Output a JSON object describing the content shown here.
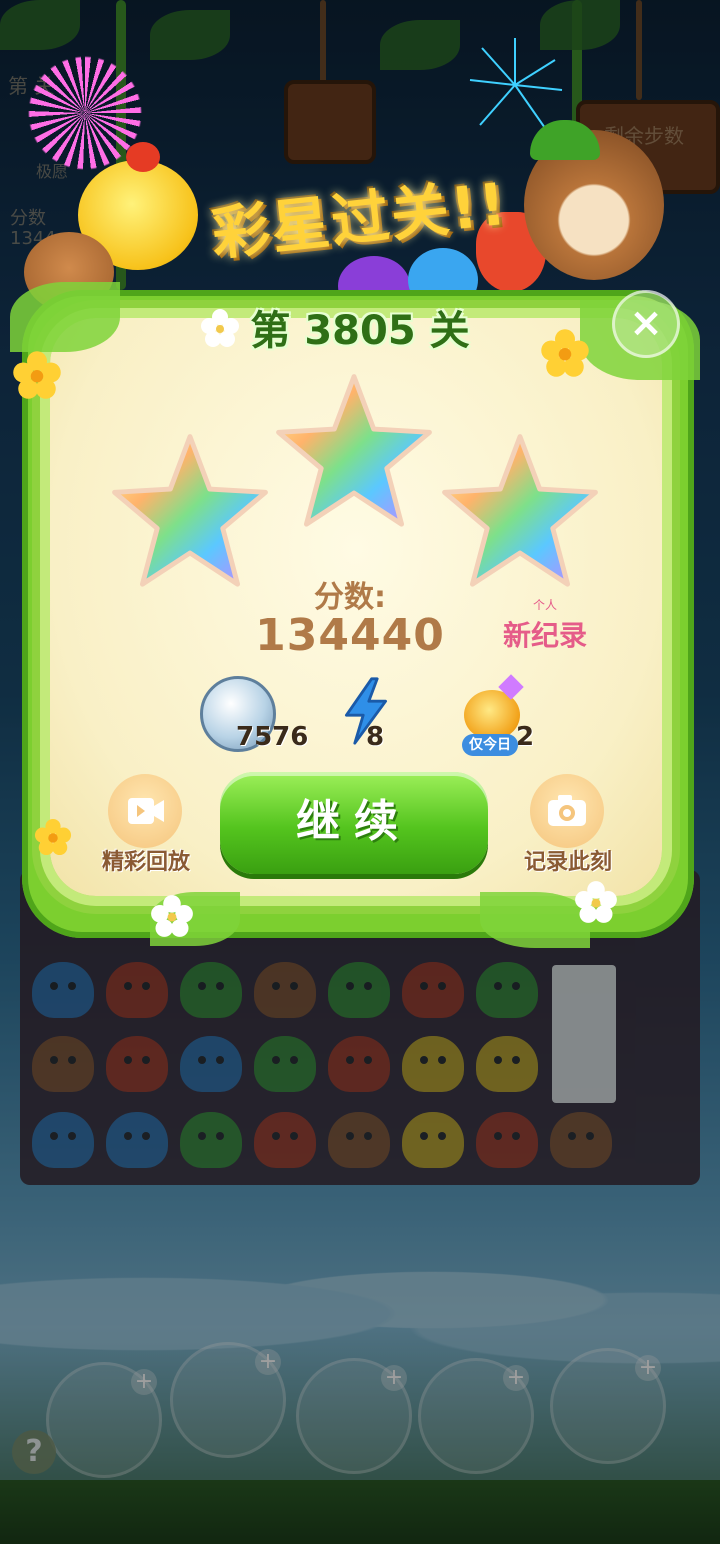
{
  "banner": {
    "text": "彩星过关!!"
  },
  "dialog": {
    "level_title": "第 3805 关",
    "close_icon": "close-icon",
    "stars_earned": 3,
    "score_label": "分数:",
    "score_value": "134440",
    "record_badge_small": "个人",
    "record_badge": "新纪录"
  },
  "rewards": [
    {
      "icon": "silver-coin-icon",
      "value": "7576"
    },
    {
      "icon": "lightning-icon",
      "value": "8"
    },
    {
      "icon": "potion-icon",
      "value": "2",
      "tag": "仅今日"
    }
  ],
  "buttons": {
    "continue": "继续",
    "replay": "精彩回放",
    "snapshot": "记录此刻"
  },
  "background": {
    "hud_level": "第 关",
    "hud_score": "分数",
    "hud_score_value": "1344",
    "hud_remaining": "剩余步数",
    "hud_side": "极愿",
    "help": "?"
  },
  "colors": {
    "accent_green": "#54c41e",
    "score_brown": "#b07a48",
    "record_pink": "#e55c89"
  }
}
